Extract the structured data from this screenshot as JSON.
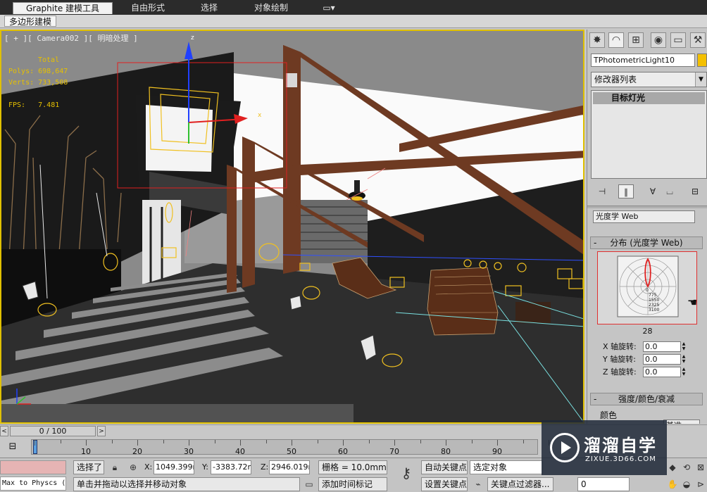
{
  "ribbon": {
    "tabs": [
      "Graphite 建模工具",
      "自由形式",
      "选择",
      "对象绘制"
    ],
    "sub_tab": "多边形建模"
  },
  "viewport": {
    "label": "[ + ][ Camera002 ][ 明暗处理 ]",
    "stats": {
      "total_label": "Total",
      "polys": "Polys: 698,647",
      "verts": "Verts: 733,508",
      "fps": "FPS:   7.481"
    },
    "gizmo_axes": {
      "x": "x",
      "y": "y",
      "z": "z"
    }
  },
  "command_panel": {
    "tab_icons": [
      "create-icon",
      "modify-icon",
      "hierarchy-icon",
      "motion-icon",
      "display-icon",
      "utilities-icon"
    ],
    "object_name": "TPhotometricLight10",
    "object_color": "#f4c000",
    "modifier_list": "修改器列表",
    "stack_item": "目标灯光",
    "distribution_dropdown": "光度学 Web",
    "rollout_distribution": "分布 (光度学 Web)",
    "web_values": [
      "0",
      "775",
      "1550",
      "2325",
      "3100"
    ],
    "web_count": "28",
    "x_rotation_label": "X 轴旋转:",
    "x_rotation": "0.0",
    "y_rotation_label": "Y 轴旋转:",
    "y_rotation": "0.0",
    "z_rotation_label": "Z 轴旋转:",
    "z_rotation": "0.0",
    "rollout_intensity": "强度/颜色/衰减",
    "color_label": "颜色",
    "base_dropdown": "基准"
  },
  "timeline": {
    "frame": "0 / 100",
    "prev": "<",
    "next": ">",
    "ticks": [
      "10",
      "20",
      "30",
      "40",
      "50",
      "60",
      "70",
      "80",
      "90"
    ]
  },
  "status": {
    "maxscript": "Max to Physcs (",
    "selected": "选择了",
    "x_label": "X:",
    "x_value": "1049.399m",
    "y_label": "Y:",
    "y_value": "-3383.72m",
    "z_label": "Z:",
    "z_value": "2946.019m",
    "grid": "栅格 = 10.0mm",
    "auto_key": "自动关键点",
    "selection_set": "选定对象",
    "set_key": "设置关键点",
    "key_filters": "关键点过滤器...",
    "prompt": "单击并拖动以选择并移动对象",
    "add_time_tag": "添加时间标记",
    "frame_field": "0"
  },
  "watermark": {
    "title": "溜溜自学",
    "url": "ZIXUE.3D66.COM"
  }
}
